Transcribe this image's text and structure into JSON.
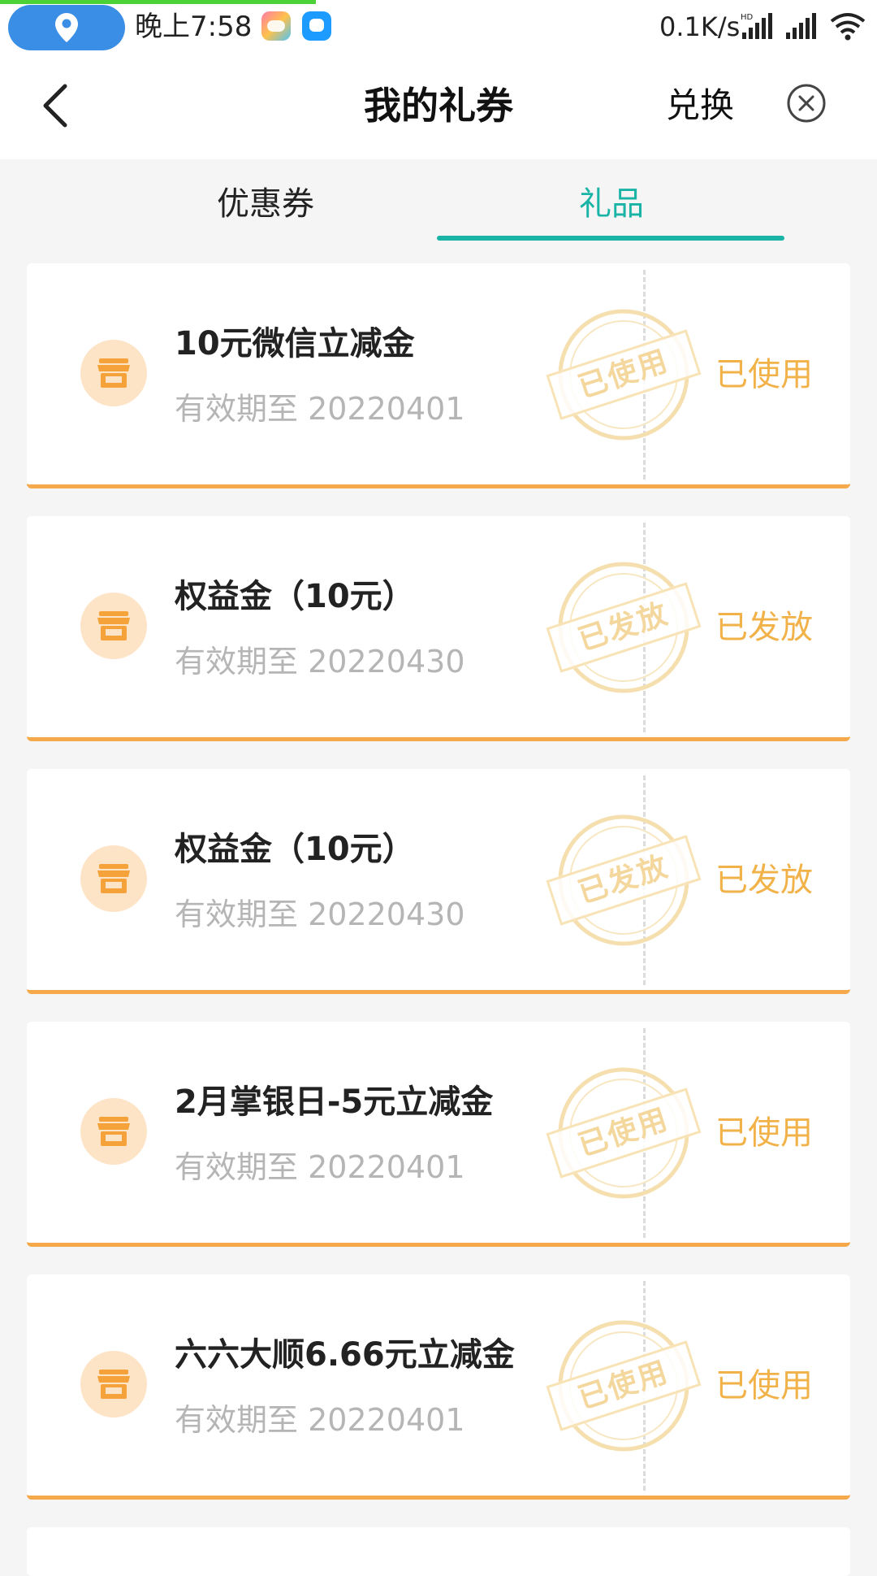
{
  "status_bar": {
    "time": "晚上7:58",
    "network_speed": "0.1K/s",
    "icons": [
      "location-icon",
      "game-app-icon",
      "chat-app-icon",
      "hd-signal-icon",
      "signal-icon",
      "wifi-icon"
    ],
    "progress": 0.36,
    "colors": {
      "location_pill": "#3a8ee6",
      "progress": "#4cd137"
    }
  },
  "header": {
    "back_icon": "chevron-left-icon",
    "title": "我的礼券",
    "exchange_label": "兑换",
    "close_icon": "close-circle-icon"
  },
  "tabs": {
    "items": [
      {
        "label": "优惠券",
        "active": false
      },
      {
        "label": "礼品",
        "active": true
      }
    ],
    "active_color": "#19b4a5"
  },
  "list": {
    "items": [
      {
        "title": "10元微信立减金",
        "expiry": "有效期至 20220401",
        "stamp": "已使用",
        "status": "已使用"
      },
      {
        "title": "权益金（10元）",
        "expiry": "有效期至 20220430",
        "stamp": "已发放",
        "status": "已发放"
      },
      {
        "title": "权益金（10元）",
        "expiry": "有效期至 20220430",
        "stamp": "已发放",
        "status": "已发放"
      },
      {
        "title": "2月掌银日-5元立减金",
        "expiry": "有效期至 20220401",
        "stamp": "已使用",
        "status": "已使用"
      },
      {
        "title": "六六大顺6.66元立减金",
        "expiry": "有效期至 20220401",
        "stamp": "已使用",
        "status": "已使用"
      }
    ],
    "card_icon": "store-icon",
    "accent_color": "#f5a94b"
  }
}
